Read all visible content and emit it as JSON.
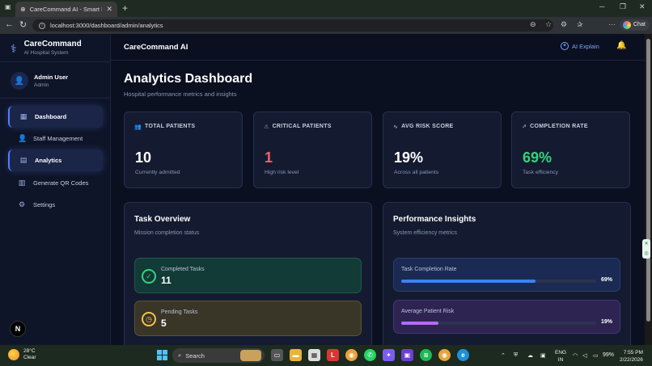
{
  "browser": {
    "tab_title": "CareCommand AI - Smart Digital H",
    "url": "localhost:3000/dashboard/admin/analytics",
    "chat_label": "Chat"
  },
  "sidebar": {
    "brand_name": "CareCommand",
    "brand_sub": "AI Hospital System",
    "user_name": "Admin User",
    "user_role": "Admin",
    "items": [
      {
        "label": "Dashboard",
        "icon": "dashboard-icon",
        "active": true
      },
      {
        "label": "Staff Management",
        "icon": "staff-icon",
        "active": false
      },
      {
        "label": "Analytics",
        "icon": "analytics-icon",
        "active": true
      },
      {
        "label": "Generate QR Codes",
        "icon": "qr-icon",
        "active": false
      },
      {
        "label": "Settings",
        "icon": "gear-icon",
        "active": false
      }
    ],
    "n_badge": "N"
  },
  "header": {
    "app_name": "CareCommand AI",
    "ai_explain": "AI Explain"
  },
  "page": {
    "title": "Analytics Dashboard",
    "subtitle": "Hospital performance metrics and insights"
  },
  "stats": [
    {
      "label": "TOTAL PATIENTS",
      "value": "10",
      "caption": "Currently admitted",
      "color": "#ffffff"
    },
    {
      "label": "CRITICAL PATIENTS",
      "value": "1",
      "caption": "High risk level",
      "color": "#f0616d"
    },
    {
      "label": "AVG RISK SCORE",
      "value": "19%",
      "caption": "Across all patients",
      "color": "#ffffff"
    },
    {
      "label": "COMPLETION RATE",
      "value": "69%",
      "caption": "Task efficiency",
      "color": "#34d37e"
    }
  ],
  "task_overview": {
    "title": "Task Overview",
    "subtitle": "Mission completion status",
    "completed_label": "Completed Tasks",
    "completed_value": "11",
    "pending_label": "Pending Tasks",
    "pending_value": "5"
  },
  "performance": {
    "title": "Performance Insights",
    "subtitle": "System efficiency metrics",
    "metrics": [
      {
        "label": "Task Completion Rate",
        "value": "69%",
        "fraction": 0.69,
        "color": "#3b82f6"
      },
      {
        "label": "Average Patient Risk",
        "value": "19%",
        "fraction": 0.19,
        "color": "#b46cf2"
      }
    ]
  },
  "taskbar": {
    "weather_temp": "28°C",
    "weather_desc": "Clear",
    "search_placeholder": "Search",
    "lang_top": "ENG",
    "lang_bottom": "IN",
    "battery": "99%",
    "time": "7:55 PM",
    "date": "2/22/2026"
  }
}
